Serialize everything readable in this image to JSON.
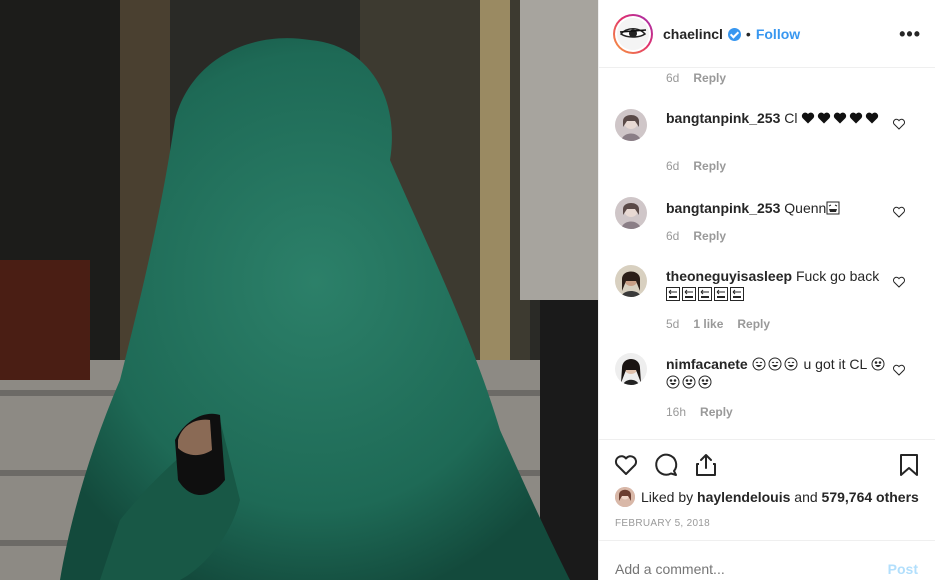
{
  "post": {
    "username": "chaelincl",
    "follow_label": "Follow",
    "separator": "•",
    "more_label": "•••"
  },
  "first_comment_meta": {
    "time": "6d",
    "reply_label": "Reply"
  },
  "comments": [
    {
      "username": "bangtanpink_253",
      "text": "Cl",
      "time": "6d",
      "likes": "",
      "reply_label": "Reply"
    },
    {
      "username": "bangtanpink_253",
      "text": "Quenn",
      "time": "6d",
      "likes": "",
      "reply_label": "Reply"
    },
    {
      "username": "theoneguyisasleep",
      "text": "Fuck go back",
      "time": "5d",
      "likes": "1 like",
      "reply_label": "Reply"
    },
    {
      "username": "nimfacanete",
      "text": "u got it CL",
      "time": "16h",
      "likes": "",
      "reply_label": "Reply"
    }
  ],
  "likes": {
    "prefix": "Liked by",
    "liker": "haylendelouis",
    "joiner": "and",
    "count": "579,764 others"
  },
  "date": "FEBRUARY 5, 2018",
  "add_comment": {
    "placeholder": "Add a comment...",
    "post_label": "Post"
  },
  "colors": {
    "accent": "#3897f0",
    "muted": "#999999",
    "fur": "#1f6b57"
  },
  "icons": [
    "heart-icon",
    "comment-icon",
    "share-icon",
    "bookmark-icon",
    "verified-icon",
    "more-icon"
  ]
}
